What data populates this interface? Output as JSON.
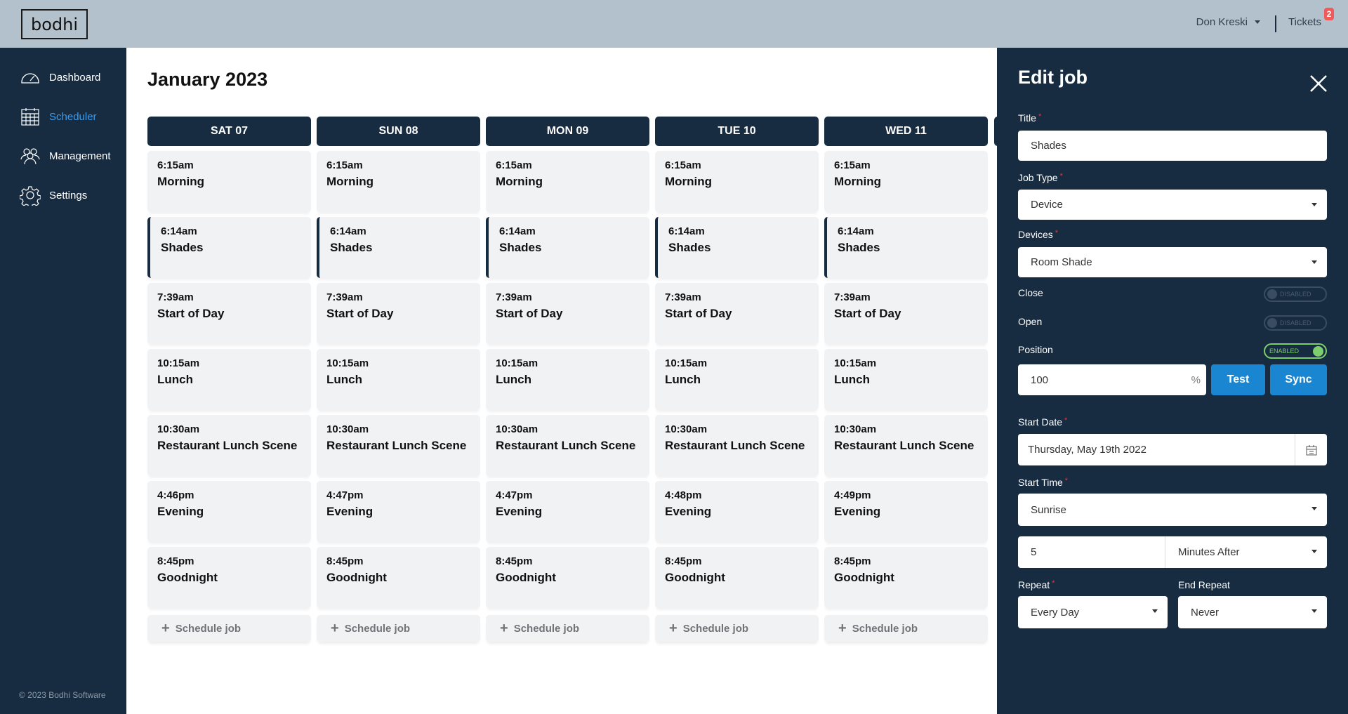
{
  "header": {
    "logo": "bodhi",
    "user": "Don Kreski",
    "tickets_label": "Tickets",
    "tickets_count": "2"
  },
  "sidebar": {
    "items": [
      {
        "label": "Dashboard",
        "icon": "gauge-icon",
        "active": false
      },
      {
        "label": "Scheduler",
        "icon": "calendar-grid-icon",
        "active": true
      },
      {
        "label": "Management",
        "icon": "users-icon",
        "active": false
      },
      {
        "label": "Settings",
        "icon": "gear-icon",
        "active": false
      }
    ],
    "copyright": "© 2023 Bodhi Software"
  },
  "calendar": {
    "month": "January 2023",
    "schedule_label": "Schedule job",
    "days": [
      {
        "label": "SAT 07",
        "jobs": [
          {
            "time": "6:15am",
            "name": "Morning"
          },
          {
            "time": "6:14am",
            "name": "Shades"
          },
          {
            "time": "7:39am",
            "name": "Start of Day"
          },
          {
            "time": "10:15am",
            "name": "Lunch"
          },
          {
            "time": "10:30am",
            "name": "Restaurant Lunch Scene"
          },
          {
            "time": "4:46pm",
            "name": "Evening"
          },
          {
            "time": "8:45pm",
            "name": "Goodnight"
          }
        ]
      },
      {
        "label": "SUN 08",
        "jobs": [
          {
            "time": "6:15am",
            "name": "Morning"
          },
          {
            "time": "6:14am",
            "name": "Shades"
          },
          {
            "time": "7:39am",
            "name": "Start of Day"
          },
          {
            "time": "10:15am",
            "name": "Lunch"
          },
          {
            "time": "10:30am",
            "name": "Restaurant Lunch Scene"
          },
          {
            "time": "4:47pm",
            "name": "Evening"
          },
          {
            "time": "8:45pm",
            "name": "Goodnight"
          }
        ]
      },
      {
        "label": "MON 09",
        "jobs": [
          {
            "time": "6:15am",
            "name": "Morning"
          },
          {
            "time": "6:14am",
            "name": "Shades"
          },
          {
            "time": "7:39am",
            "name": "Start of Day"
          },
          {
            "time": "10:15am",
            "name": "Lunch"
          },
          {
            "time": "10:30am",
            "name": "Restaurant Lunch Scene"
          },
          {
            "time": "4:47pm",
            "name": "Evening"
          },
          {
            "time": "8:45pm",
            "name": "Goodnight"
          }
        ]
      },
      {
        "label": "TUE 10",
        "jobs": [
          {
            "time": "6:15am",
            "name": "Morning"
          },
          {
            "time": "6:14am",
            "name": "Shades"
          },
          {
            "time": "7:39am",
            "name": "Start of Day"
          },
          {
            "time": "10:15am",
            "name": "Lunch"
          },
          {
            "time": "10:30am",
            "name": "Restaurant Lunch Scene"
          },
          {
            "time": "4:48pm",
            "name": "Evening"
          },
          {
            "time": "8:45pm",
            "name": "Goodnight"
          }
        ]
      },
      {
        "label": "WED 11",
        "jobs": [
          {
            "time": "6:15am",
            "name": "Morning"
          },
          {
            "time": "6:14am",
            "name": "Shades"
          },
          {
            "time": "7:39am",
            "name": "Start of Day"
          },
          {
            "time": "10:15am",
            "name": "Lunch"
          },
          {
            "time": "10:30am",
            "name": "Restaurant Lunch Scene"
          },
          {
            "time": "4:49pm",
            "name": "Evening"
          },
          {
            "time": "8:45pm",
            "name": "Goodnight"
          }
        ]
      }
    ]
  },
  "edit_job": {
    "title": "Edit job",
    "fields": {
      "title": {
        "label": "Title",
        "value": "Shades"
      },
      "job_type": {
        "label": "Job Type",
        "value": "Device"
      },
      "devices": {
        "label": "Devices",
        "value": "Room Shade"
      },
      "close": {
        "label": "Close",
        "state": "DISABLED"
      },
      "open": {
        "label": "Open",
        "state": "DISABLED"
      },
      "position": {
        "label": "Position",
        "state": "ENABLED",
        "value": "100",
        "unit": "%"
      },
      "start_date": {
        "label": "Start Date",
        "value": "Thursday, May 19th 2022"
      },
      "start_time": {
        "label": "Start Time",
        "value": "Sunrise",
        "offset": "5",
        "offset_unit": "Minutes After"
      },
      "repeat": {
        "label": "Repeat",
        "value": "Every Day"
      },
      "end_repeat": {
        "label": "End Repeat",
        "value": "Never"
      }
    },
    "buttons": {
      "test": "Test",
      "sync": "Sync"
    },
    "colors": {
      "accent": "#1a85d0",
      "enabled": "#7ccf6c",
      "navy": "#172b41"
    }
  }
}
